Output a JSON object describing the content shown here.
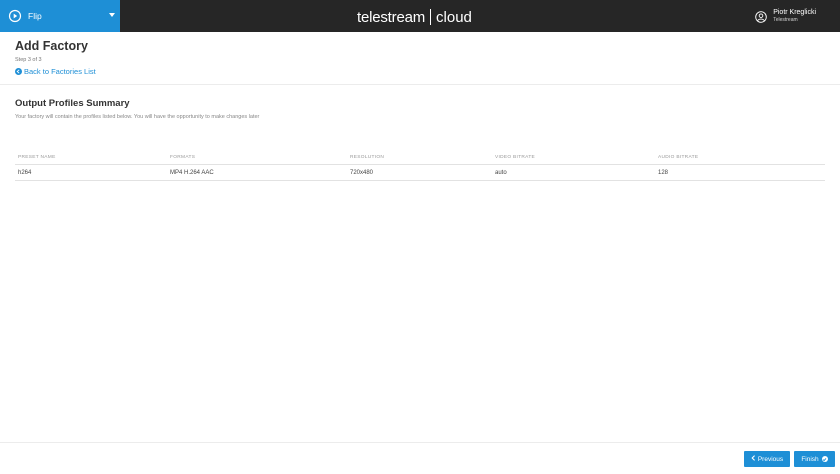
{
  "topbar": {
    "app_name": "Flip",
    "brand_main": "telestream",
    "brand_sub": "cloud",
    "user_name": "Piotr Kreglicki",
    "user_org": "Telestream"
  },
  "header": {
    "title": "Add Factory",
    "step": "Step 3 of 3",
    "back_link": "Back to Factories List"
  },
  "summary": {
    "title": "Output Profiles Summary",
    "description": "Your factory will contain the profiles listed below. You will have the opportunity to make changes later",
    "columns": [
      "PRESET NAME",
      "FORMATS",
      "RESOLUTION",
      "VIDEO BITRATE",
      "AUDIO BITRATE"
    ],
    "rows": [
      [
        "h264",
        "MP4 H.264 AAC",
        "720x480",
        "auto",
        "128"
      ]
    ]
  },
  "footer": {
    "previous_label": "Previous",
    "finish_label": "Finish"
  },
  "colors": {
    "accent": "#1e8fd6",
    "topbar": "#262626"
  },
  "icons": [
    "flip-app-icon",
    "caret-down-icon",
    "user-avatar-icon",
    "arrow-left-circle-icon",
    "chevron-left-icon",
    "check-circle-icon"
  ]
}
